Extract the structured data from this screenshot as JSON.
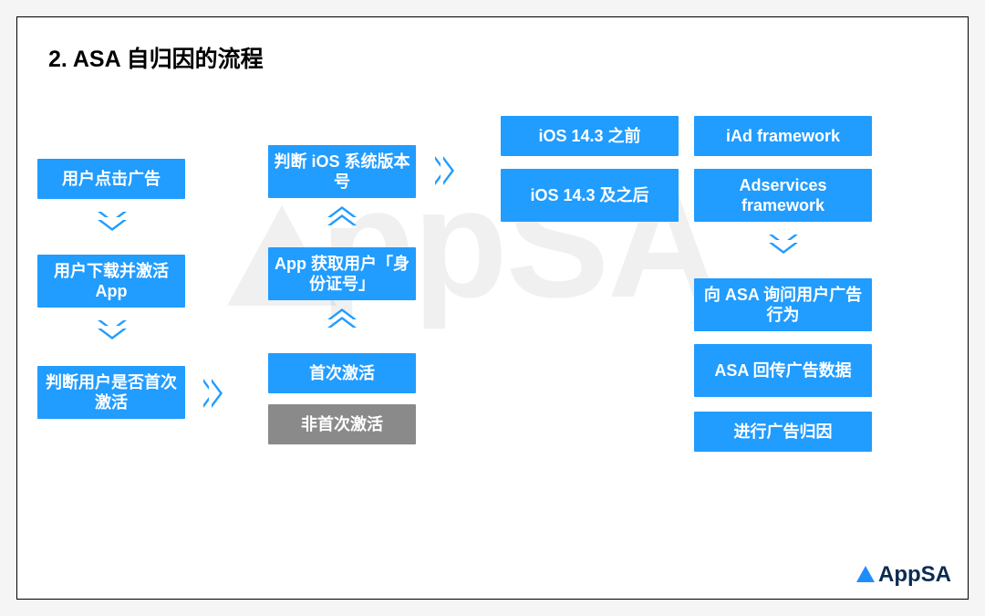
{
  "title": "2. ASA 自归因的流程",
  "col1": {
    "b1": "用户点击广告",
    "b2": "用户下载并激活 App",
    "b3": "判断用户是否首次激活"
  },
  "col2": {
    "top": "判断 iOS 系统版本号",
    "mid": "App 获取用户「身份证号」",
    "first": "首次激活",
    "notfirst": "非首次激活"
  },
  "branch": {
    "pre": "iOS 14.3 之前",
    "post": "iOS 14.3 及之后",
    "iad": "iAd framework",
    "adservices": "Adservices framework"
  },
  "col4": {
    "query": "向 ASA 询问用户广告行为",
    "return": "ASA 回传广告数据",
    "attr": "进行广告归因"
  },
  "logo_text": "AppSA"
}
